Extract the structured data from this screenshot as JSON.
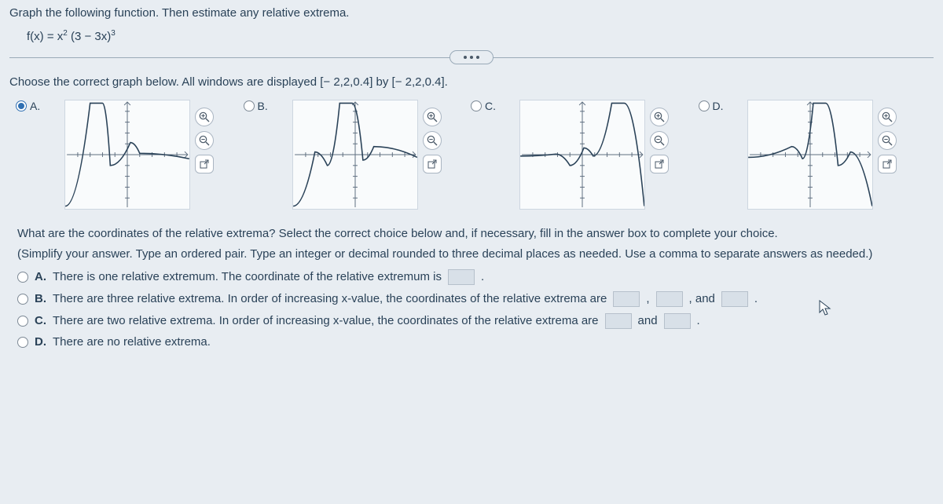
{
  "prompt": "Graph the following function. Then estimate any relative extrema.",
  "function_prefix": "f(x) = x",
  "function_exp1": "2",
  "function_mid": " (3 − 3x)",
  "function_exp2": "3",
  "sub_prompt": "Choose the correct graph below. All windows are displayed [− 2,2,0.4] by [− 2,2,0.4].",
  "graph_labels": {
    "a": "A.",
    "b": "B.",
    "c": "C.",
    "d": "D."
  },
  "q_line1": "What are the coordinates of the relative extrema? Select the correct choice below and, if necessary, fill in the answer box to complete your choice.",
  "q_line2": "(Simplify your answer. Type an ordered pair. Type an integer or decimal rounded to three decimal places as needed. Use a comma to separate answers as needed.)",
  "choices": {
    "a_prefix": "A.",
    "a_text_1": "There is one relative extremum. The coordinate of the relative extremum is",
    "b_prefix": "B.",
    "b_text_1": "There are three relative extrema. In order of increasing x-value, the coordinates of the relative extrema are",
    "b_text_2": ",",
    "b_text_3": ", and",
    "c_prefix": "C.",
    "c_text_1": "There are two relative extrema. In order of increasing x-value, the coordinates of the relative extrema are",
    "c_text_2": "and",
    "d_prefix": "D.",
    "d_text": "There are no relative extrema."
  },
  "icons": {
    "zoom_in": "magnify-plus-icon",
    "zoom_out": "magnify-minus-icon",
    "open": "open-new-icon"
  },
  "chart_data": [
    {
      "type": "line",
      "window_x": [
        -2,
        2
      ],
      "tick_x": 0.4,
      "window_y": [
        -2,
        2
      ],
      "tick_y": 0.4,
      "label": "A",
      "selected": true,
      "curve": [
        [
          -2,
          -1.9
        ],
        [
          -1.2,
          1.9
        ],
        [
          -0.8,
          1.9
        ],
        [
          -0.55,
          -0.4
        ],
        [
          0.1,
          0.45
        ],
        [
          0.4,
          0.05
        ],
        [
          2,
          -0.15
        ]
      ]
    },
    {
      "type": "line",
      "window_x": [
        -2,
        2
      ],
      "tick_x": 0.4,
      "window_y": [
        -2,
        2
      ],
      "tick_y": 0.4,
      "label": "B",
      "selected": false,
      "curve": [
        [
          -2,
          -1.9
        ],
        [
          -1.3,
          0.1
        ],
        [
          -0.9,
          -0.4
        ],
        [
          -0.5,
          1.9
        ],
        [
          -0.1,
          1.9
        ],
        [
          0.25,
          -0.2
        ],
        [
          0.6,
          0.3
        ],
        [
          2,
          -0.1
        ]
      ]
    },
    {
      "type": "line",
      "window_x": [
        -2,
        2
      ],
      "tick_x": 0.4,
      "window_y": [
        -2,
        2
      ],
      "tick_y": 0.4,
      "label": "C",
      "selected": false,
      "curve": [
        [
          -2,
          -0.05
        ],
        [
          -0.85,
          0.02
        ],
        [
          -0.4,
          -0.4
        ],
        [
          0.05,
          0.25
        ],
        [
          0.35,
          -0.05
        ],
        [
          0.95,
          1.9
        ],
        [
          1.35,
          1.9
        ],
        [
          2,
          -1.9
        ]
      ]
    },
    {
      "type": "line",
      "window_x": [
        -2,
        2
      ],
      "tick_x": 0.4,
      "window_y": [
        -2,
        2
      ],
      "tick_y": 0.4,
      "label": "D",
      "selected": false,
      "curve": [
        [
          -2,
          -0.1
        ],
        [
          -0.6,
          0.3
        ],
        [
          -0.25,
          -0.15
        ],
        [
          0.1,
          1.9
        ],
        [
          0.5,
          1.9
        ],
        [
          0.9,
          -0.4
        ],
        [
          1.3,
          0.1
        ],
        [
          2,
          -1.9
        ]
      ]
    }
  ]
}
